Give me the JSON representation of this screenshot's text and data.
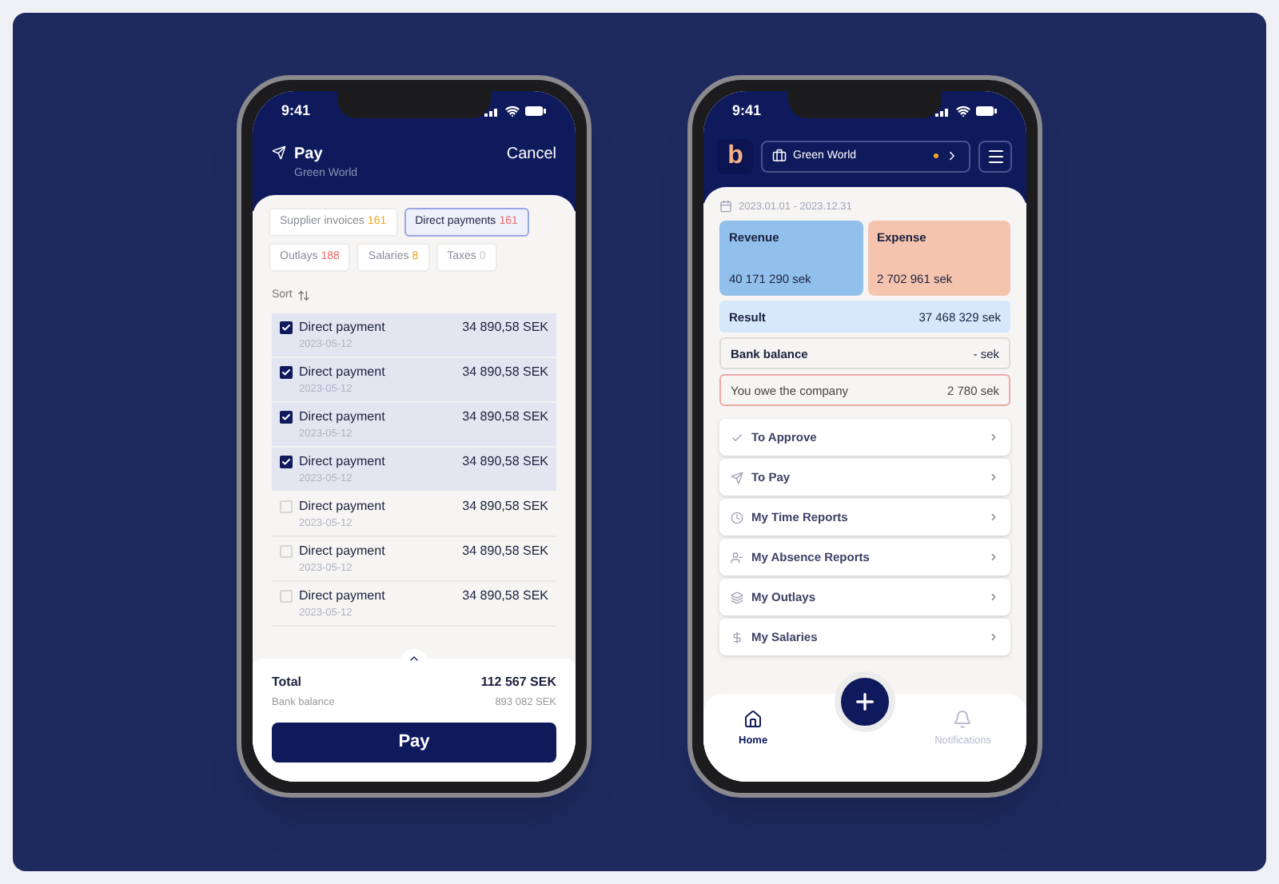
{
  "pay_screen": {
    "status_time": "9:41",
    "title": "Pay",
    "subtitle": "Green World",
    "cancel": "Cancel",
    "tabs": [
      {
        "label": "Supplier invoices",
        "count": "161",
        "color": "#f5a623",
        "selected": false
      },
      {
        "label": "Direct payments",
        "count": "161",
        "color": "#f06a6a",
        "selected": true
      },
      {
        "label": "Outlays",
        "count": "188",
        "color": "#f06a6a",
        "selected": false
      },
      {
        "label": "Salaries",
        "count": "8",
        "color": "#f5a623",
        "selected": false
      },
      {
        "label": "Taxes",
        "count": "0",
        "color": "#c8c8c8",
        "selected": false
      }
    ],
    "sort_label": "Sort",
    "payments": [
      {
        "title": "Direct payment",
        "date": "2023-05-12",
        "amount": "34 890,58 SEK",
        "checked": true
      },
      {
        "title": "Direct payment",
        "date": "2023-05-12",
        "amount": "34 890,58 SEK",
        "checked": true
      },
      {
        "title": "Direct payment",
        "date": "2023-05-12",
        "amount": "34 890,58 SEK",
        "checked": true
      },
      {
        "title": "Direct payment",
        "date": "2023-05-12",
        "amount": "34 890,58 SEK",
        "checked": true
      },
      {
        "title": "Direct payment",
        "date": "2023-05-12",
        "amount": "34 890,58 SEK",
        "checked": false
      },
      {
        "title": "Direct payment",
        "date": "2023-05-12",
        "amount": "34 890,58 SEK",
        "checked": false
      },
      {
        "title": "Direct payment",
        "date": "2023-05-12",
        "amount": "34 890,58 SEK",
        "checked": false
      }
    ],
    "total_label": "Total",
    "total": "112 567 SEK",
    "bank_balance_label": "Bank balance",
    "bank_balance": "893 082 SEK",
    "pay_button": "Pay"
  },
  "home_screen": {
    "status_time": "9:41",
    "logo": "b",
    "company": "Green World",
    "date_range": "2023.01.01 - 2023.12.31",
    "revenue": {
      "label": "Revenue",
      "value": "40 171 290 sek"
    },
    "expense": {
      "label": "Expense",
      "value": "2 702 961 sek"
    },
    "result": {
      "label": "Result",
      "value": "37 468 329 sek"
    },
    "bank_balance": {
      "label": "Bank balance",
      "value": "- sek"
    },
    "owe": {
      "label": "You owe the company",
      "value": "2 780 sek"
    },
    "menu": [
      {
        "label": "To Approve"
      },
      {
        "label": "To Pay"
      },
      {
        "label": "My Time Reports"
      },
      {
        "label": "My Absence Reports"
      },
      {
        "label": "My Outlays"
      },
      {
        "label": "My Salaries"
      }
    ],
    "nav": [
      {
        "label": "Home",
        "selected": true
      },
      {
        "label": "Notifications",
        "selected": false
      }
    ]
  }
}
